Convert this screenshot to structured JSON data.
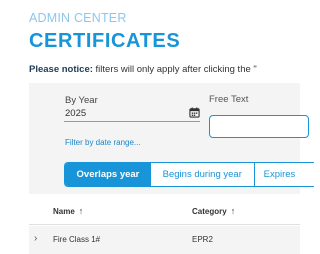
{
  "header": {
    "kicker": "ADMIN CENTER",
    "title": "CERTIFICATES"
  },
  "notice": {
    "label": "Please notice:",
    "text": " filters will only apply after clicking the \""
  },
  "filters": {
    "by_year_label": "By Year",
    "year_value": "2025",
    "date_range_link": "Filter by date range...",
    "free_text_label": "Free Text",
    "free_text_value": "",
    "modes": [
      "Overlaps year",
      "Begins during year",
      "Expires"
    ],
    "active_mode": "Overlaps year"
  },
  "table": {
    "columns": [
      {
        "label": "Name",
        "sort_icon": "arrow-up-icon"
      },
      {
        "label": "Category",
        "sort_icon": "arrow-up-icon"
      }
    ],
    "rows": [
      {
        "name": "Fire Class 1#",
        "category": "EPR2",
        "expand_icon": "chevron-right-icon"
      }
    ]
  },
  "colors": {
    "accent": "#1795d8",
    "kicker": "#8cc7ee",
    "panel": "#f4f4f4"
  }
}
